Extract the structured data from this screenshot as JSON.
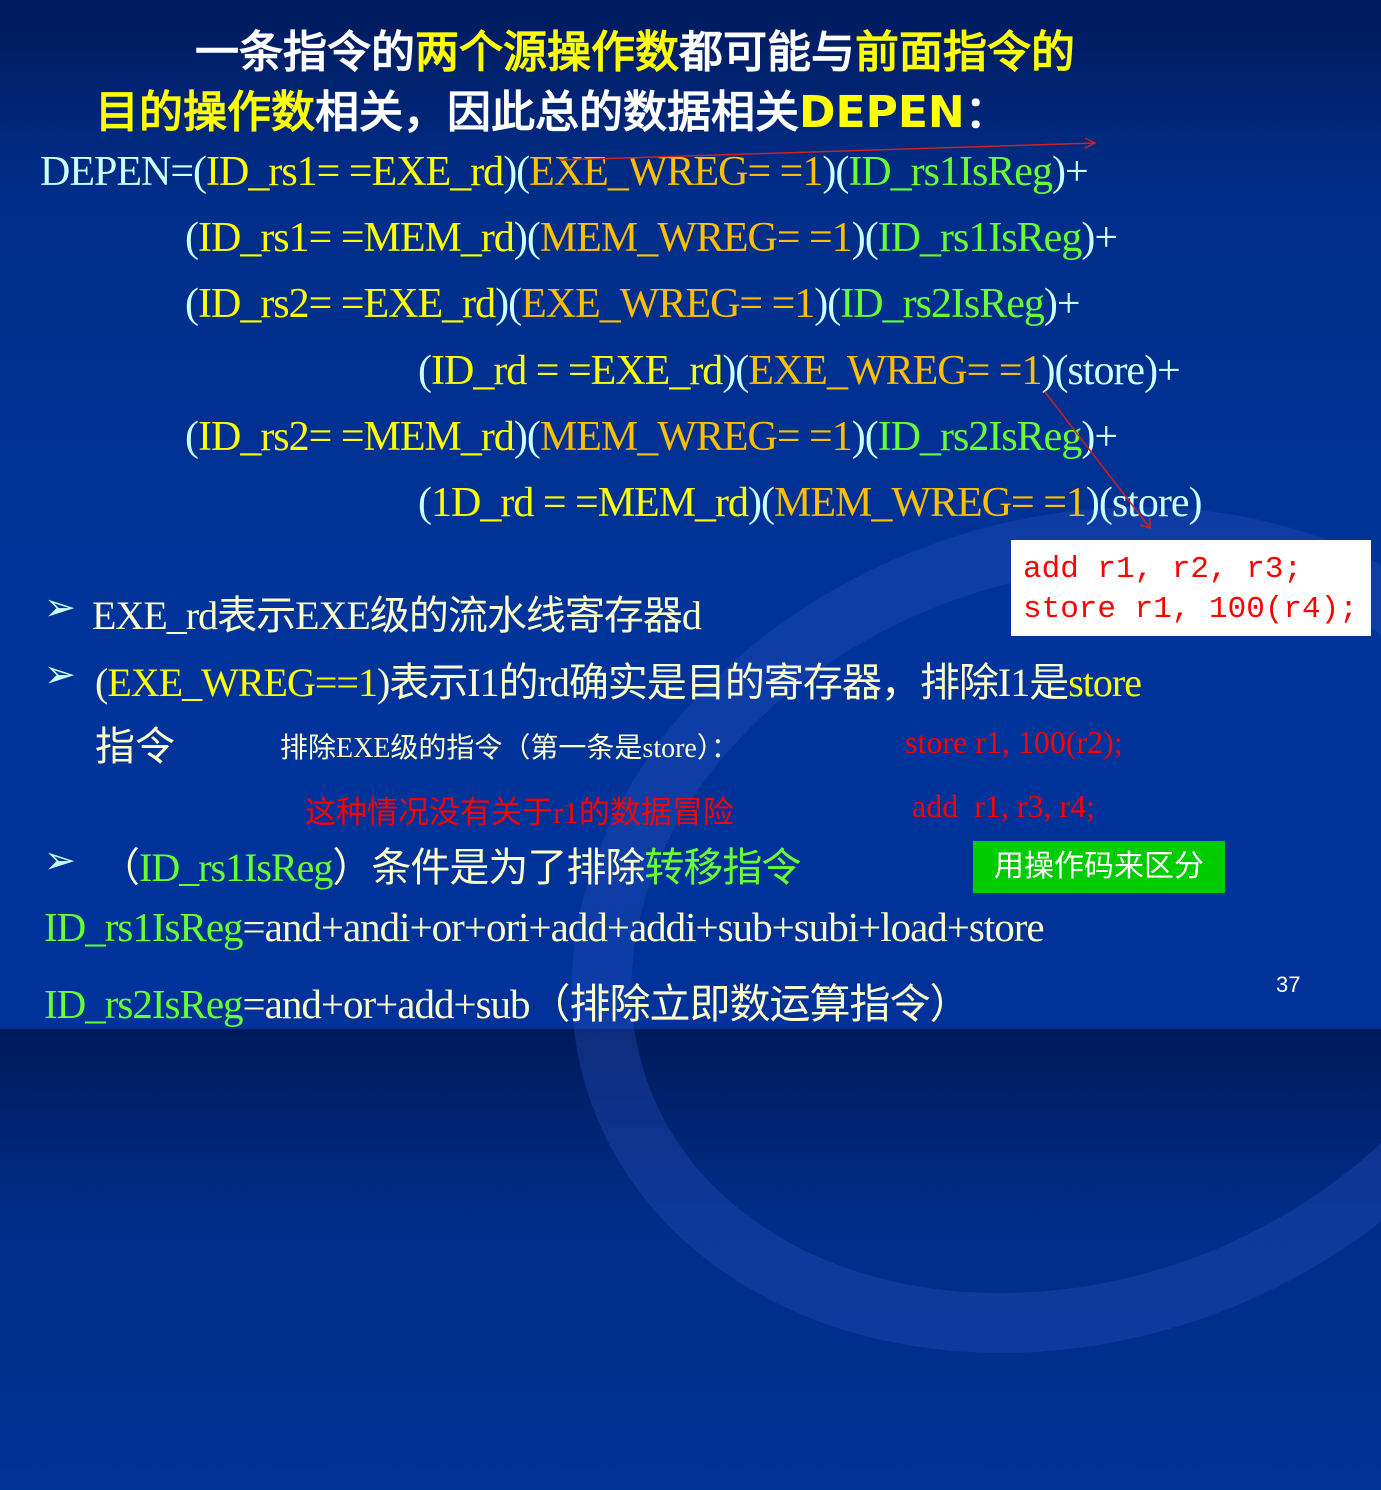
{
  "title": {
    "line1": [
      {
        "t": "一条指令的",
        "c": "white"
      },
      {
        "t": "两个源操作数",
        "c": "yellow"
      },
      {
        "t": "都可能与",
        "c": "white"
      },
      {
        "t": "前面指令的",
        "c": "yellow"
      }
    ],
    "line2": [
      {
        "t": "目的操作数",
        "c": "yellow"
      },
      {
        "t": "相关，因此总的数据相关",
        "c": "white"
      },
      {
        "t": "DEPEN",
        "c": "yellow"
      },
      {
        "t": "：",
        "c": "white"
      }
    ]
  },
  "formula": [
    [
      {
        "t": "DEPEN=",
        "c": "cyan"
      },
      {
        "t": "(",
        "c": "cyan"
      },
      {
        "t": "ID_rs1= =EXE_rd",
        "c": "yellow"
      },
      {
        "t": ")(",
        "c": "cyan"
      },
      {
        "t": "EXE_WREG= =1",
        "c": "orange"
      },
      {
        "t": ")(",
        "c": "cyan"
      },
      {
        "t": "ID_rs1IsReg",
        "c": "green"
      },
      {
        "t": ")+",
        "c": "cyan"
      }
    ],
    [
      {
        "t": "(",
        "c": "cyan"
      },
      {
        "t": "ID_rs1= =MEM_rd",
        "c": "yellow"
      },
      {
        "t": ")(",
        "c": "cyan"
      },
      {
        "t": "MEM_WREG= =1",
        "c": "orange"
      },
      {
        "t": ")(",
        "c": "cyan"
      },
      {
        "t": "ID_rs1IsReg",
        "c": "green"
      },
      {
        "t": ")+",
        "c": "cyan"
      }
    ],
    [
      {
        "t": "(",
        "c": "cyan"
      },
      {
        "t": "ID_rs2= =EXE_rd",
        "c": "yellow"
      },
      {
        "t": ")(",
        "c": "cyan"
      },
      {
        "t": "EXE_WREG= =1",
        "c": "orange"
      },
      {
        "t": ")(",
        "c": "cyan"
      },
      {
        "t": "ID_rs2IsReg",
        "c": "green"
      },
      {
        "t": ")+",
        "c": "cyan"
      }
    ],
    [
      {
        "t": "(",
        "c": "cyan"
      },
      {
        "t": "ID_rd = =EXE_rd",
        "c": "yellow"
      },
      {
        "t": ")(",
        "c": "cyan"
      },
      {
        "t": "EXE_WREG= =1",
        "c": "orange"
      },
      {
        "t": ")(store)+",
        "c": "cyan"
      }
    ],
    [
      {
        "t": "(",
        "c": "cyan"
      },
      {
        "t": "ID_rs2= =MEM_rd",
        "c": "yellow"
      },
      {
        "t": ")(",
        "c": "cyan"
      },
      {
        "t": "MEM_WREG= =1",
        "c": "orange"
      },
      {
        "t": ")(",
        "c": "cyan"
      },
      {
        "t": "ID_rs2IsReg",
        "c": "green"
      },
      {
        "t": ")+",
        "c": "cyan"
      }
    ],
    [
      {
        "t": "(",
        "c": "cyan"
      },
      {
        "t": "1D_rd = =MEM_rd",
        "c": "yellow"
      },
      {
        "t": ")(",
        "c": "cyan"
      },
      {
        "t": "MEM_WREG= =1",
        "c": "orange"
      },
      {
        "t": ")(store)",
        "c": "cyan"
      }
    ]
  ],
  "code_box": {
    "line1": "add r1, r2, r3;",
    "line2": "store r1, 100(r4);"
  },
  "bullets": [
    [
      {
        "t": "EXE_rd表示EXE级的流水线寄存器d",
        "c": "cream"
      }
    ],
    [
      {
        "t": "(",
        "c": "cream"
      },
      {
        "t": "EXE_WREG==1",
        "c": "yellow"
      },
      {
        "t": ")表示I1的rd确实是目的寄存器，排除I1是",
        "c": "cream"
      },
      {
        "t": "store",
        "c": "yellow"
      }
    ],
    [
      {
        "t": "（",
        "c": "cream"
      },
      {
        "t": "ID_rs1IsReg",
        "c": "green"
      },
      {
        "t": "）条件是为了排除",
        "c": "cream"
      },
      {
        "t": "转移指令",
        "c": "green"
      }
    ]
  ],
  "bullet2_cont": "指令",
  "note_exe": "排除EXE级的指令（第一条是store）：",
  "note_store": "store r1, 100(r2);",
  "note_hazard": "这种情况没有关于r1的数据冒险",
  "note_add": "add  r1, r3, r4;",
  "opcode_box": "用操作码来区分",
  "rs1_def": [
    {
      "t": "ID_rs1IsReg",
      "c": "green"
    },
    {
      "t": "=and+andi+or+ori+add+addi+sub+subi+load+store",
      "c": "cream"
    }
  ],
  "rs2_def": [
    {
      "t": "ID_rs2IsReg",
      "c": "green"
    },
    {
      "t": "=and+or+add+sub",
      "c": "cream"
    },
    {
      "t": "（排除立即数运算指令）",
      "c": "cream"
    }
  ],
  "page_number": "37"
}
